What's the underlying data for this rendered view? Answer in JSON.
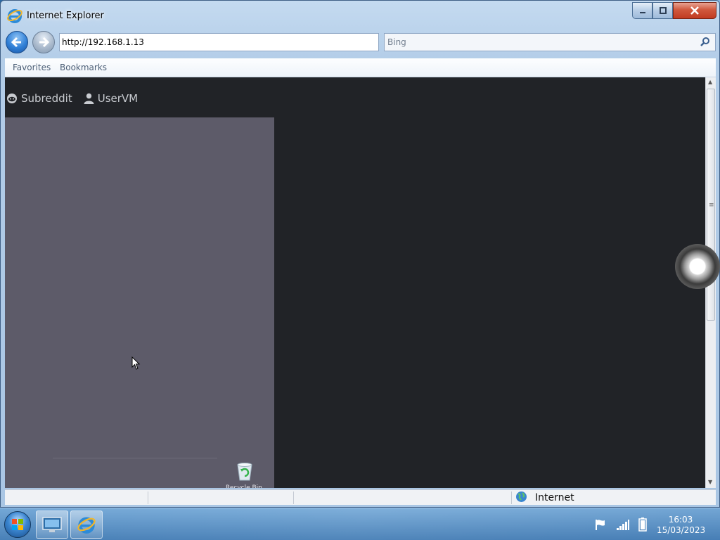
{
  "window": {
    "title": "Internet Explorer",
    "minimize_icon": "minimize-icon",
    "maximize_icon": "maximize-icon",
    "close_icon": "close-icon"
  },
  "nav": {
    "address": "http://192.168.1.13",
    "search_placeholder": "Bing"
  },
  "favorites_bar": {
    "items": [
      "Favorites",
      "Bookmarks"
    ]
  },
  "page": {
    "topnav": [
      {
        "label": "Subreddit",
        "icon": "reddit-icon"
      },
      {
        "label": "UserVM",
        "icon": "user-icon"
      }
    ]
  },
  "status_bar": {
    "zone": "Internet"
  },
  "taskbar": {
    "time": "16:03",
    "date": "15/03/2023"
  },
  "colors": {
    "page_background": "#212327",
    "panel": "#5d5b69",
    "accent_blue": "#2f7fd6"
  }
}
